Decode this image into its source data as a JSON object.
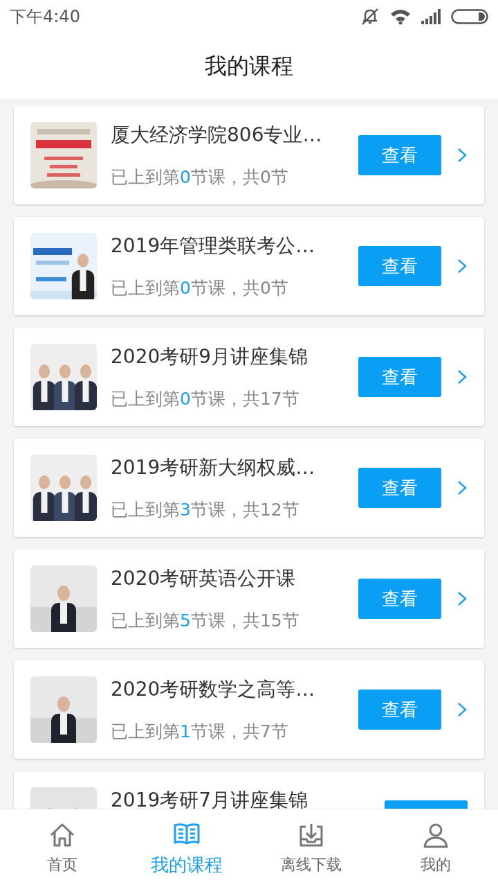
{
  "status_bar": {
    "time": "下午4:40"
  },
  "header": {
    "title": "我的课程"
  },
  "courses": [
    {
      "title": "厦大经济学院806专业…",
      "progress_prefix": "已上到第",
      "progress_count": "0",
      "progress_suffix": "节课，共0节",
      "button": "查看"
    },
    {
      "title": "2019年管理类联考公…",
      "progress_prefix": "已上到第",
      "progress_count": "0",
      "progress_suffix": "节课，共0节",
      "button": "查看"
    },
    {
      "title": "2020考研9月讲座集锦",
      "progress_prefix": "已上到第",
      "progress_count": "0",
      "progress_suffix": "节课，共17节",
      "button": "查看"
    },
    {
      "title": "2019考研新大纲权威…",
      "progress_prefix": "已上到第",
      "progress_count": "3",
      "progress_suffix": "节课，共12节",
      "button": "查看"
    },
    {
      "title": "2020考研英语公开课",
      "progress_prefix": "已上到第",
      "progress_count": "5",
      "progress_suffix": "节课，共15节",
      "button": "查看"
    },
    {
      "title": "2020考研数学之高等…",
      "progress_prefix": "已上到第",
      "progress_count": "1",
      "progress_suffix": "节课，共7节",
      "button": "查看"
    },
    {
      "title": "2019考研7月讲座集锦"
    }
  ],
  "tab_bar": [
    {
      "label": "首页",
      "selected": false
    },
    {
      "label": "我的课程",
      "selected": true
    },
    {
      "label": "离线下载",
      "selected": false
    },
    {
      "label": "我的",
      "selected": false
    }
  ]
}
